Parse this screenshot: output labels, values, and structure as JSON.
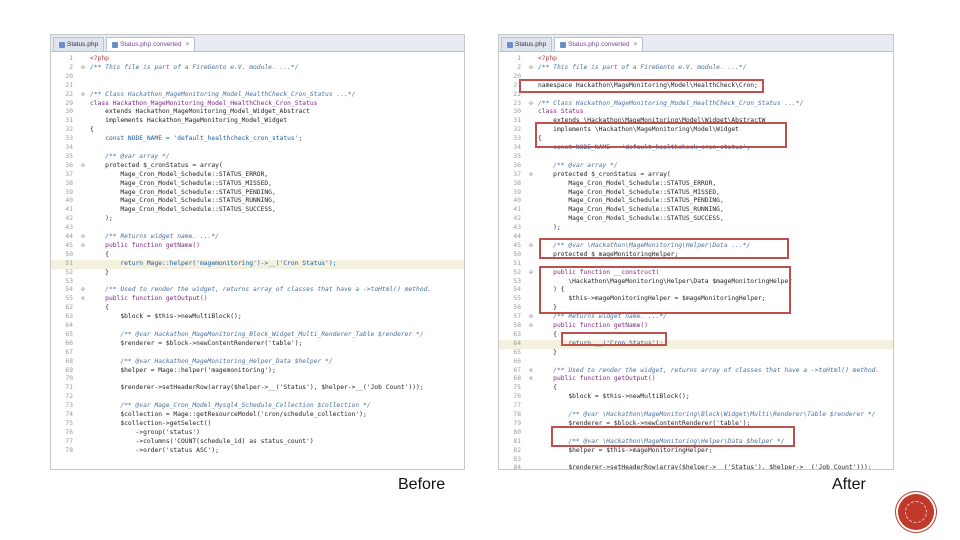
{
  "before": {
    "caption": "Before",
    "tabs": [
      {
        "label": "Status.php",
        "active": false
      },
      {
        "label": "Status.php converted",
        "active": true
      }
    ],
    "lines": [
      {
        "n": "1",
        "code": "<?php",
        "cls": "ph"
      },
      {
        "n": "2",
        "fold": "⊖",
        "code": "/** This file is part of a FireGento e.V. module. ...*/",
        "cls": "cm"
      },
      {
        "n": "20",
        "code": ""
      },
      {
        "n": "21",
        "code": ""
      },
      {
        "n": "22",
        "fold": "⊖",
        "code": "/** Class Hackathon_MageMonitoring_Model_HealthCheck_Cron_Status ...*/",
        "cls": "cm"
      },
      {
        "n": "29",
        "code": "class Hackathon_MageMonitoring_Model_HealthCheck_Cron_Status",
        "cls": "kw"
      },
      {
        "n": "30",
        "code": "    extends Hackathon_MageMonitoring_Model_Widget_Abstract"
      },
      {
        "n": "31",
        "code": "    implements Hackathon_MageMonitoring_Model_Widget"
      },
      {
        "n": "32",
        "code": "{"
      },
      {
        "n": "33",
        "code": "    const NODE_NAME = 'default_healthcheck_cron_status';",
        "cls": "str"
      },
      {
        "n": "34",
        "code": ""
      },
      {
        "n": "35",
        "code": "    /** @var array */",
        "cls": "cm"
      },
      {
        "n": "36",
        "fold": "⊖",
        "code": "    protected $_cronStatus = array("
      },
      {
        "n": "37",
        "code": "        Mage_Cron_Model_Schedule::STATUS_ERROR,"
      },
      {
        "n": "38",
        "code": "        Mage_Cron_Model_Schedule::STATUS_MISSED,"
      },
      {
        "n": "39",
        "code": "        Mage_Cron_Model_Schedule::STATUS_PENDING,"
      },
      {
        "n": "40",
        "code": "        Mage_Cron_Model_Schedule::STATUS_RUNNING,"
      },
      {
        "n": "41",
        "code": "        Mage_Cron_Model_Schedule::STATUS_SUCCESS,"
      },
      {
        "n": "42",
        "code": "    );"
      },
      {
        "n": "43",
        "code": ""
      },
      {
        "n": "44",
        "fold": "⊖",
        "code": "    /** Returns widget name. ...*/",
        "cls": "cm"
      },
      {
        "n": "45",
        "fold": "⊖",
        "code": "    public function getName()",
        "cls": "kw"
      },
      {
        "n": "50",
        "code": "    {"
      },
      {
        "n": "51",
        "code": "        return Mage::helper('magemonitoring')->__('Cron Status');",
        "cls": "str",
        "hl": true
      },
      {
        "n": "52",
        "code": "    }"
      },
      {
        "n": "53",
        "code": ""
      },
      {
        "n": "54",
        "fold": "⊖",
        "code": "    /** Used to render the widget, returns array of classes that have a ->toHtml() method.",
        "cls": "cm"
      },
      {
        "n": "55",
        "fold": "⊖",
        "code": "    public function getOutput()",
        "cls": "kw"
      },
      {
        "n": "62",
        "code": "    {"
      },
      {
        "n": "63",
        "code": "        $block = $this->newMultiBlock();"
      },
      {
        "n": "64",
        "code": ""
      },
      {
        "n": "65",
        "code": "        /** @var Hackathon_MageMonitoring_Block_Widget_Multi_Renderer_Table $renderer */",
        "cls": "cm"
      },
      {
        "n": "66",
        "code": "        $renderer = $block->newContentRenderer('table');"
      },
      {
        "n": "67",
        "code": ""
      },
      {
        "n": "68",
        "code": "        /** @var Hackathon_MageMonitoring_Helper_Data $helper */",
        "cls": "cm"
      },
      {
        "n": "69",
        "code": "        $helper = Mage::helper('magemonitoring');"
      },
      {
        "n": "70",
        "code": ""
      },
      {
        "n": "71",
        "code": "        $renderer->setHeaderRow(array($helper->__('Status'), $helper->__('Job Count')));"
      },
      {
        "n": "72",
        "code": ""
      },
      {
        "n": "73",
        "code": "        /** @var Mage_Cron_Model_Mysql4_Schedule_Collection $collection */",
        "cls": "cm"
      },
      {
        "n": "74",
        "code": "        $collection = Mage::getResourceModel('cron/schedule_collection');"
      },
      {
        "n": "75",
        "code": "        $collection->getSelect()"
      },
      {
        "n": "76",
        "code": "            ->group('status')"
      },
      {
        "n": "77",
        "code": "            ->columns('COUNT(schedule_id) as status_count')"
      },
      {
        "n": "78",
        "code": "            ->order('status ASC');"
      }
    ]
  },
  "after": {
    "caption": "After",
    "tabs": [
      {
        "label": "Status.php",
        "active": false
      },
      {
        "label": "Status.php converted",
        "active": true
      }
    ],
    "lines": [
      {
        "n": "1",
        "code": "<?php",
        "cls": "ph"
      },
      {
        "n": "2",
        "fold": "⊖",
        "code": "/** This file is part of a FireGento e.V. module. ...*/",
        "cls": "cm"
      },
      {
        "n": "20",
        "code": ""
      },
      {
        "n": "21",
        "code": "namespace Hackathon\\MageMonitoring\\Model\\HealthCheck\\Cron;"
      },
      {
        "n": "22",
        "code": ""
      },
      {
        "n": "23",
        "fold": "⊖",
        "code": "/** Class Hackathon_MageMonitoring_Model_HealthCheck_Cron_Status ...*/",
        "cls": "cm"
      },
      {
        "n": "30",
        "code": "class Status",
        "cls": "kw"
      },
      {
        "n": "31",
        "code": "    extends \\Hackathon\\MageMonitoring\\Model\\Widget\\AbstractW"
      },
      {
        "n": "32",
        "code": "    implements \\Hackathon\\MageMonitoring\\Model\\Widget"
      },
      {
        "n": "33",
        "code": "{"
      },
      {
        "n": "34",
        "code": "    const NODE_NAME = 'default_healthcheck_cron_status';",
        "cls": "str"
      },
      {
        "n": "35",
        "code": ""
      },
      {
        "n": "36",
        "code": "    /** @var array */",
        "cls": "cm"
      },
      {
        "n": "37",
        "fold": "⊖",
        "code": "    protected $_cronStatus = array("
      },
      {
        "n": "38",
        "code": "        Mage_Cron_Model_Schedule::STATUS_ERROR,"
      },
      {
        "n": "39",
        "code": "        Mage_Cron_Model_Schedule::STATUS_MISSED,"
      },
      {
        "n": "40",
        "code": "        Mage_Cron_Model_Schedule::STATUS_PENDING,"
      },
      {
        "n": "41",
        "code": "        Mage_Cron_Model_Schedule::STATUS_RUNNING,"
      },
      {
        "n": "42",
        "code": "        Mage_Cron_Model_Schedule::STATUS_SUCCESS,"
      },
      {
        "n": "43",
        "code": "    );"
      },
      {
        "n": "44",
        "code": ""
      },
      {
        "n": "45",
        "fold": "⊖",
        "code": "    /** @var \\Hackathon\\MageMonitoring\\Helper\\Data ...*/",
        "cls": "cm"
      },
      {
        "n": "50",
        "code": "    protected $_mageMonitoringHelper;"
      },
      {
        "n": "51",
        "code": ""
      },
      {
        "n": "52",
        "fold": "⊖",
        "code": "    public function __construct(",
        "cls": "kw"
      },
      {
        "n": "53",
        "code": "        \\Hackathon\\MageMonitoring\\Helper\\Data $mageMonitoringHelper"
      },
      {
        "n": "54",
        "code": "    ) {"
      },
      {
        "n": "55",
        "code": "        $this->mageMonitoringHelper = $mageMonitoringHelper;"
      },
      {
        "n": "56",
        "code": "    }"
      },
      {
        "n": "57",
        "fold": "⊖",
        "code": "    /** Returns widget name. ...*/",
        "cls": "cm"
      },
      {
        "n": "58",
        "fold": "⊖",
        "code": "    public function getName()",
        "cls": "kw"
      },
      {
        "n": "63",
        "code": "    {"
      },
      {
        "n": "64",
        "code": "        return __('Cron Status');",
        "cls": "str",
        "hl": true
      },
      {
        "n": "65",
        "code": "    }"
      },
      {
        "n": "66",
        "code": ""
      },
      {
        "n": "67",
        "fold": "⊖",
        "code": "    /** Used to render the widget, returns array of classes that have a ->toHtml() method.",
        "cls": "cm"
      },
      {
        "n": "68",
        "fold": "⊖",
        "code": "    public function getOutput()",
        "cls": "kw"
      },
      {
        "n": "75",
        "code": "    {"
      },
      {
        "n": "76",
        "code": "        $block = $this->newMultiBlock();"
      },
      {
        "n": "77",
        "code": ""
      },
      {
        "n": "78",
        "code": "        /** @var \\Hackathon\\MageMonitoring\\Block\\Widget\\Multi\\Renderer\\Table $renderer */",
        "cls": "cm"
      },
      {
        "n": "79",
        "code": "        $renderer = $block->newContentRenderer('table');"
      },
      {
        "n": "80",
        "code": ""
      },
      {
        "n": "81",
        "code": "        /** @var \\Hackathon\\MageMonitoring\\Helper\\Data $helper */",
        "cls": "cm"
      },
      {
        "n": "82",
        "code": "        $helper = $this->mageMonitoringHelper;"
      },
      {
        "n": "83",
        "code": ""
      },
      {
        "n": "84",
        "code": "        $renderer->setHeaderRow(array($helper->__('Status'), $helper->__('Job Count')));"
      }
    ]
  }
}
